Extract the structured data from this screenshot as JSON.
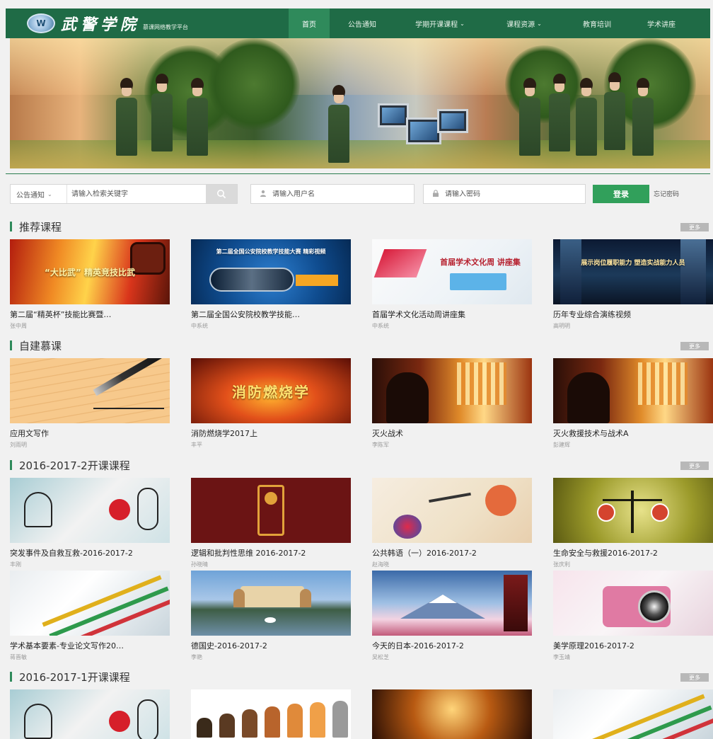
{
  "header": {
    "logo_mark": "W",
    "logo_title": "武警学院",
    "logo_subtitle": "慕课网络教学平台",
    "nav": [
      {
        "label": "首页",
        "active": true,
        "dropdown": false
      },
      {
        "label": "公告通知",
        "active": false,
        "dropdown": false
      },
      {
        "label": "学期开课课程",
        "active": false,
        "dropdown": true
      },
      {
        "label": "课程资源",
        "active": false,
        "dropdown": true
      },
      {
        "label": "教育培训",
        "active": false,
        "dropdown": false
      },
      {
        "label": "学术讲座",
        "active": false,
        "dropdown": false
      }
    ]
  },
  "search": {
    "category": "公告通知",
    "placeholder": "请输入检索关键字",
    "username_placeholder": "请输入用户名",
    "password_placeholder": "请输入密码",
    "login_label": "登录",
    "forgot_label": "忘记密码"
  },
  "more_label": "更多",
  "sections": [
    {
      "title": "推荐课程",
      "courses": [
        {
          "title": "第二届“精英杯”技能比赛暨…",
          "teacher": "张中周",
          "thumb": "fire",
          "thumb_text": "“大比武” 精英竞技比武"
        },
        {
          "title": "第二届全国公安院校教学技能…",
          "teacher": "中系统",
          "thumb": "film",
          "thumb_text": "第二届全国公安院校教学技能大赛 精彩视频"
        },
        {
          "title": "首届学术文化活动周讲座集",
          "teacher": "中系统",
          "thumb": "lecture",
          "thumb_text": "首届学术文化周 讲座集"
        },
        {
          "title": "历年专业综合演练视频",
          "teacher": "高明明",
          "thumb": "city",
          "thumb_text": "展示岗位履职能力 塑造实战能力人员"
        }
      ]
    },
    {
      "title": "自建慕课",
      "courses": [
        {
          "title": "应用文写作",
          "teacher": "刘雨明",
          "thumb": "pen",
          "thumb_text": ""
        },
        {
          "title": "消防燃烧学2017上",
          "teacher": "丰平",
          "thumb": "blaze",
          "thumb_text": "消防燃烧学"
        },
        {
          "title": "灭火战术",
          "teacher": "李陈军",
          "thumb": "fighter",
          "thumb_text": ""
        },
        {
          "title": "灭火救援技术与战术A",
          "teacher": "彭建辉",
          "thumb": "fighter",
          "thumb_text": ""
        }
      ]
    },
    {
      "title": "2016-2017-2开课课程",
      "courses": [
        {
          "title": "突发事件及自救互救-2016-2017-2",
          "teacher": "丰刚",
          "thumb": "sketch",
          "thumb_text": ""
        },
        {
          "title": "逻辑和批判性思维 2016-2017-2",
          "teacher": "孙晓晴",
          "thumb": "maroon",
          "thumb_text": ""
        },
        {
          "title": "公共韩语（一）2016-2017-2",
          "teacher": "赵海晓",
          "thumb": "ink",
          "thumb_text": ""
        },
        {
          "title": "生命安全与救援2016-2017-2",
          "teacher": "张庆利",
          "thumb": "scale",
          "thumb_text": ""
        },
        {
          "title": "学术基本要素-专业论文写作20…",
          "teacher": "蒋晋敏",
          "thumb": "pencils",
          "thumb_text": ""
        },
        {
          "title": "德国史-2016-2017-2",
          "teacher": "李艳",
          "thumb": "castle",
          "thumb_text": ""
        },
        {
          "title": "今天的日本-2016-2017-2",
          "teacher": "吴松芝",
          "thumb": "fuji",
          "thumb_text": ""
        },
        {
          "title": "美学原理2016-2017-2",
          "teacher": "李玉靖",
          "thumb": "camera",
          "thumb_text": ""
        }
      ]
    },
    {
      "title": "2016-2017-1开课课程",
      "courses": [
        {
          "title": "",
          "teacher": "",
          "thumb": "sketch",
          "thumb_text": ""
        },
        {
          "title": "",
          "teacher": "",
          "thumb": "evo",
          "thumb_text": ""
        },
        {
          "title": "",
          "teacher": "",
          "thumb": "gold",
          "thumb_text": ""
        },
        {
          "title": "",
          "teacher": "",
          "thumb": "pencils",
          "thumb_text": ""
        }
      ]
    }
  ],
  "colors": {
    "header_bg": "#1f6b46",
    "nav_active": "#2f8a5b",
    "login_button": "#31a05b",
    "section_bar": "#2f8a5b"
  }
}
